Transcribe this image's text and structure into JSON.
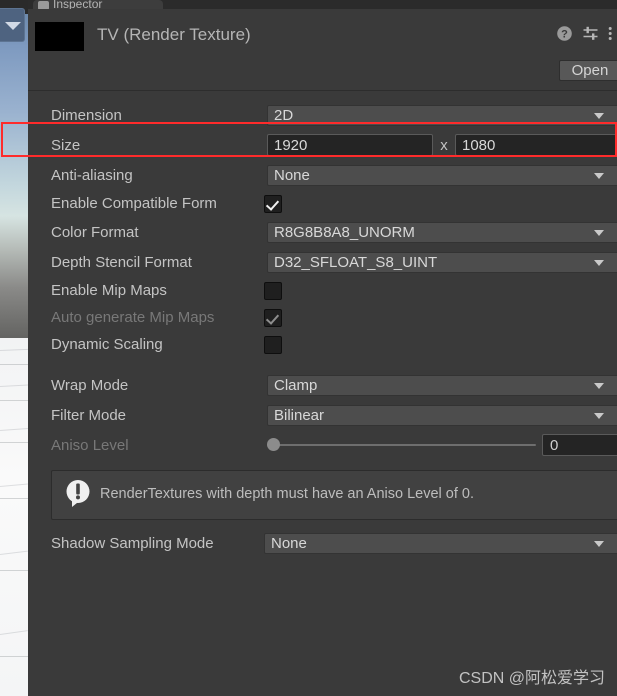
{
  "window": {
    "tab_label": "Inspector",
    "tab_icon": "inspector-icon"
  },
  "asset_header": {
    "title": "TV (Render Texture)",
    "thumbnail_color": "#000000",
    "help_icon": "help-icon",
    "preset_icon": "preset-settings-icon",
    "menu_icon": "kebab-menu-icon",
    "open_label": "Open"
  },
  "properties": [
    {
      "label": "Dimension",
      "type": "dropdown",
      "value": "2D"
    },
    {
      "label": "Size",
      "type": "size",
      "width": "1920",
      "separator": "x",
      "height": "1080"
    },
    {
      "label": "Anti-aliasing",
      "type": "dropdown",
      "value": "None"
    },
    {
      "label": "Enable Compatible Form",
      "type": "checkbox",
      "checked": true,
      "disabled": false
    },
    {
      "label": "Color Format",
      "type": "dropdown",
      "value": "R8G8B8A8_UNORM"
    },
    {
      "label": "Depth Stencil Format",
      "type": "dropdown",
      "value": "D32_SFLOAT_S8_UINT"
    },
    {
      "label": "Enable Mip Maps",
      "type": "checkbox",
      "checked": false,
      "disabled": false
    },
    {
      "label": "Auto generate Mip Maps",
      "type": "checkbox",
      "checked": true,
      "disabled": true
    },
    {
      "label": "Dynamic Scaling",
      "type": "checkbox",
      "checked": false,
      "disabled": false
    },
    {
      "label": "Wrap Mode",
      "type": "dropdown",
      "value": "Clamp"
    },
    {
      "label": "Filter Mode",
      "type": "dropdown",
      "value": "Bilinear"
    },
    {
      "label": "Aniso Level",
      "type": "slider",
      "value": "0",
      "disabled": true
    },
    {
      "label": "Shadow Sampling Mode",
      "type": "dropdown",
      "value": "None"
    }
  ],
  "info_box": {
    "icon": "warning-exclamation-icon",
    "message": "RenderTextures with depth must have an Aniso Level of 0."
  },
  "annotation": {
    "highlight_color": "#ff2b2b",
    "highlighted_row": "Size"
  },
  "watermark": {
    "text": "CSDN @阿松爱学习"
  },
  "colors": {
    "panel_background": "#3a3a3a",
    "dropdown_background": "#4d4d4d",
    "textfield_background": "#242424",
    "label_text": "#c4c4c4",
    "disabled_text": "#787878",
    "highlight": "#ff2b2b"
  }
}
